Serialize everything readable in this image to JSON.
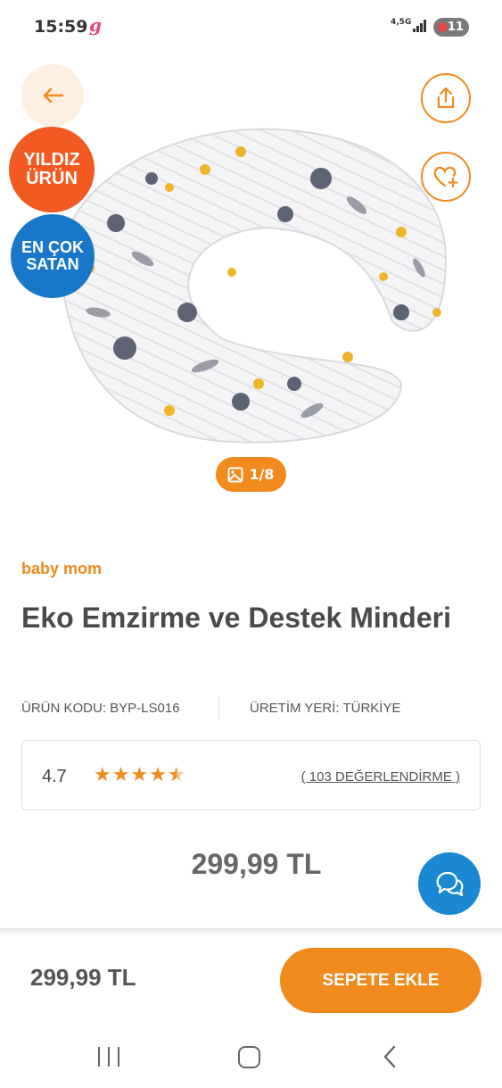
{
  "status_bar": {
    "time": "15:59",
    "app_icon": "g",
    "network": "4,5G",
    "battery": "11"
  },
  "header": {
    "back_icon": "arrow-left-icon",
    "share_icon": "share-icon",
    "favorite_icon": "heart-plus-icon"
  },
  "badges": {
    "star_line1": "YILDIZ",
    "star_line2": "ÜRÜN",
    "best_line1": "EN ÇOK",
    "best_line2": "SATAN"
  },
  "gallery": {
    "counter": "1/8",
    "icon": "image-icon"
  },
  "product": {
    "brand": "baby mom",
    "title": "Eko Emzirme ve Destek Minderi",
    "code": "ÜRÜN KODU: BYP-LS016",
    "origin": "ÜRETİM YERİ: TÜRKİYE",
    "rating": "4.7",
    "rating_stars": 4.5,
    "reviews": "( 103 DEĞERLENDİRME )",
    "price": "299,99 TL"
  },
  "bottom_bar": {
    "price": "299,99 TL",
    "add_to_cart": "SEPETE EKLE"
  },
  "colors": {
    "accent": "#f08a1c",
    "star_badge": "#f25a21",
    "best_badge": "#1877c8",
    "chat": "#1a88d3"
  }
}
